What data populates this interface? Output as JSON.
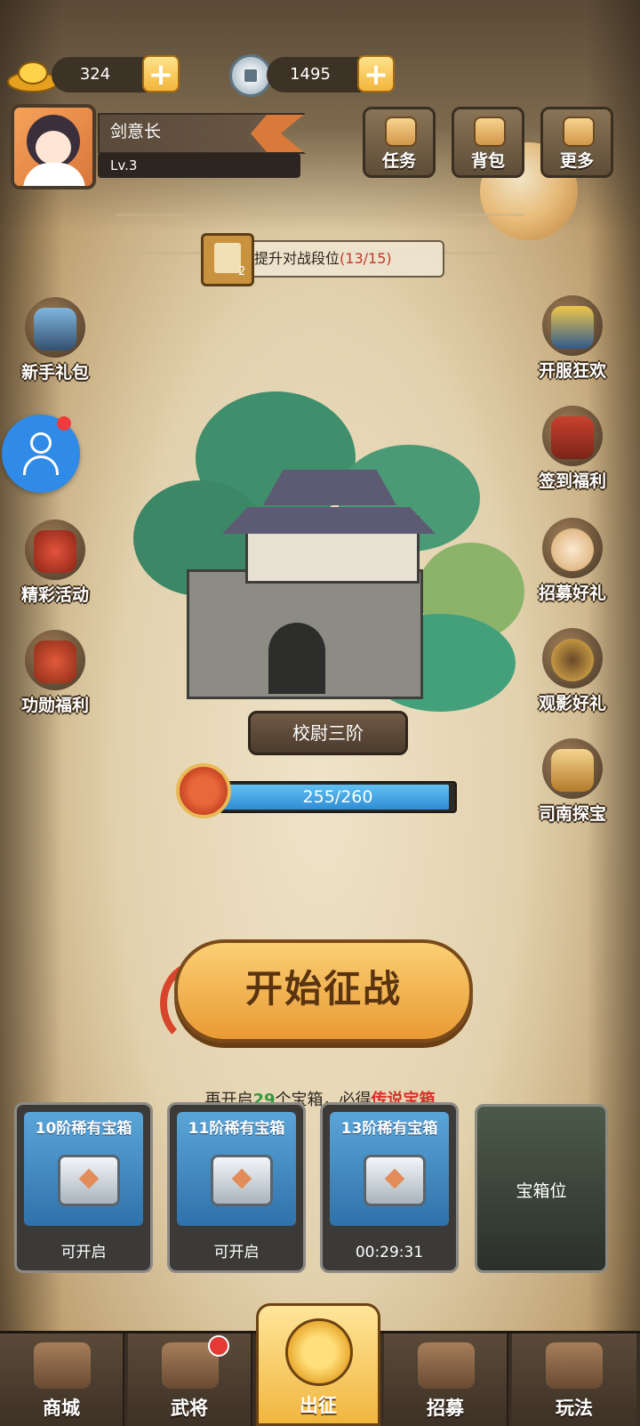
{
  "currency": {
    "gold": "324",
    "coin": "1495"
  },
  "player": {
    "name": "剑意长",
    "level": "Lv.3"
  },
  "top_buttons": {
    "quest": "任务",
    "bag": "背包",
    "more": "更多"
  },
  "objective": {
    "text": "提升对战段位",
    "progress": "(13/15)",
    "count": "2"
  },
  "left_side": {
    "newbie_pack": "新手礼包",
    "events": "精彩活动",
    "merit": "功勋福利"
  },
  "right_side": {
    "server_carnival": "开服狂欢",
    "checkin": "签到福利",
    "recruit_gift": "招募好礼",
    "watch_gift": "观影好礼",
    "compass_treasure": "司南探宝"
  },
  "rank": {
    "title": "校尉三阶",
    "xp_text": "255/260",
    "xp_fraction": 0.98
  },
  "start_button": "开始征战",
  "chest_hint": {
    "prefix": "再开启",
    "count": "29",
    "middle": "个宝箱，必得",
    "reward": "传说宝箱"
  },
  "chests": [
    {
      "title": "10阶稀有宝箱",
      "status": "可开启"
    },
    {
      "title": "11阶稀有宝箱",
      "status": "可开启"
    },
    {
      "title": "13阶稀有宝箱",
      "status": "00:29:31"
    }
  ],
  "chest_slot": "宝箱位",
  "nav": {
    "shop": "商城",
    "generals": "武将",
    "battle": "出征",
    "recruit": "招募",
    "gameplay": "玩法"
  },
  "colors": {
    "accent_orange": "#f0b63e",
    "xp_blue": "#2f8dd4",
    "legend_red": "#d8312b",
    "count_green": "#2f9b3b"
  }
}
